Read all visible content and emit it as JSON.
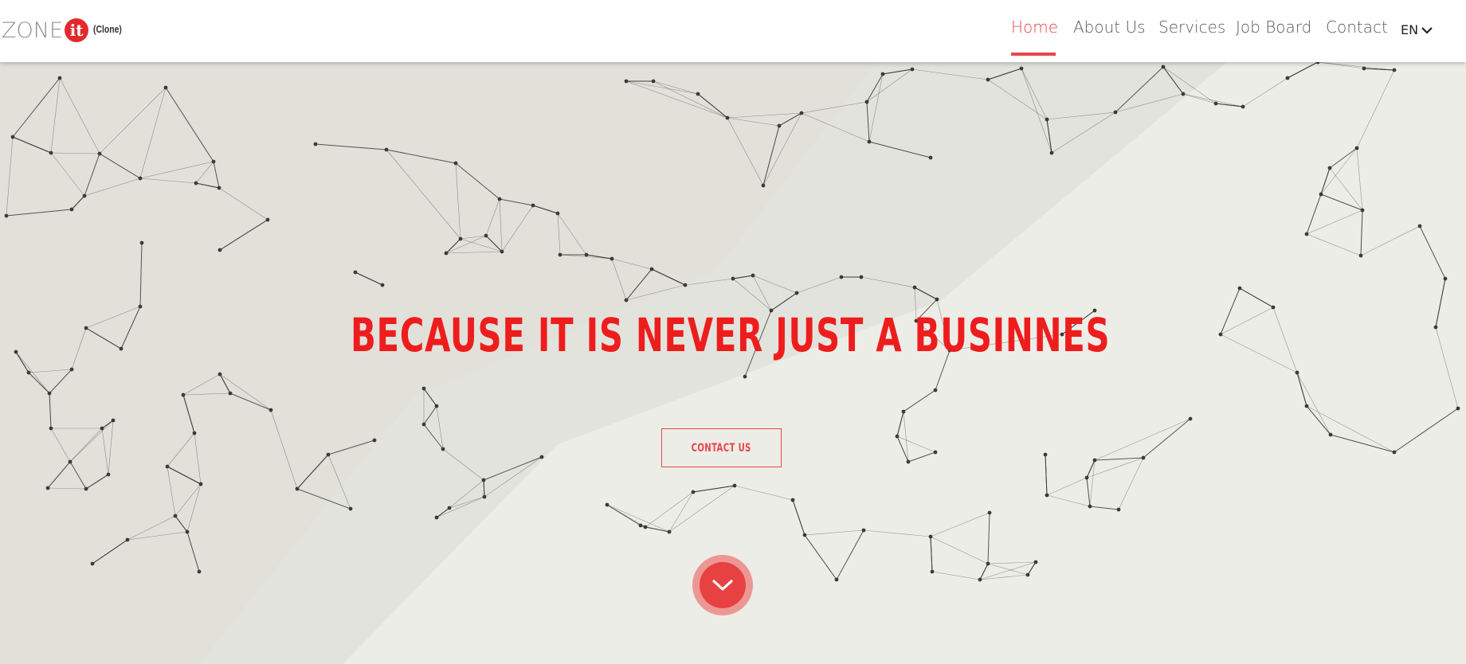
{
  "header": {
    "logo": {
      "zone_text": "ZONE",
      "it_text": "it",
      "clone_text": "(Clone)"
    },
    "nav": [
      {
        "label": "Home",
        "active": true
      },
      {
        "label": "About Us",
        "active": false
      },
      {
        "label": "Services",
        "active": false
      },
      {
        "label": "Job Board",
        "active": false
      },
      {
        "label": "Contact",
        "active": false
      }
    ],
    "language": "EN",
    "icons": {
      "language_dropdown": "chevron-down-icon"
    }
  },
  "hero": {
    "headline": "BECAUSE IT IS NEVER JUST A BUSINNES",
    "cta_label": "CONTACT US",
    "scroll_icon": "chevron-down-icon",
    "background": "polygon-network-pattern"
  },
  "colors": {
    "accent": "#e8454a",
    "headline": "#ee1d1d",
    "background": "#eeeeea",
    "nav_text": "#555a60"
  }
}
